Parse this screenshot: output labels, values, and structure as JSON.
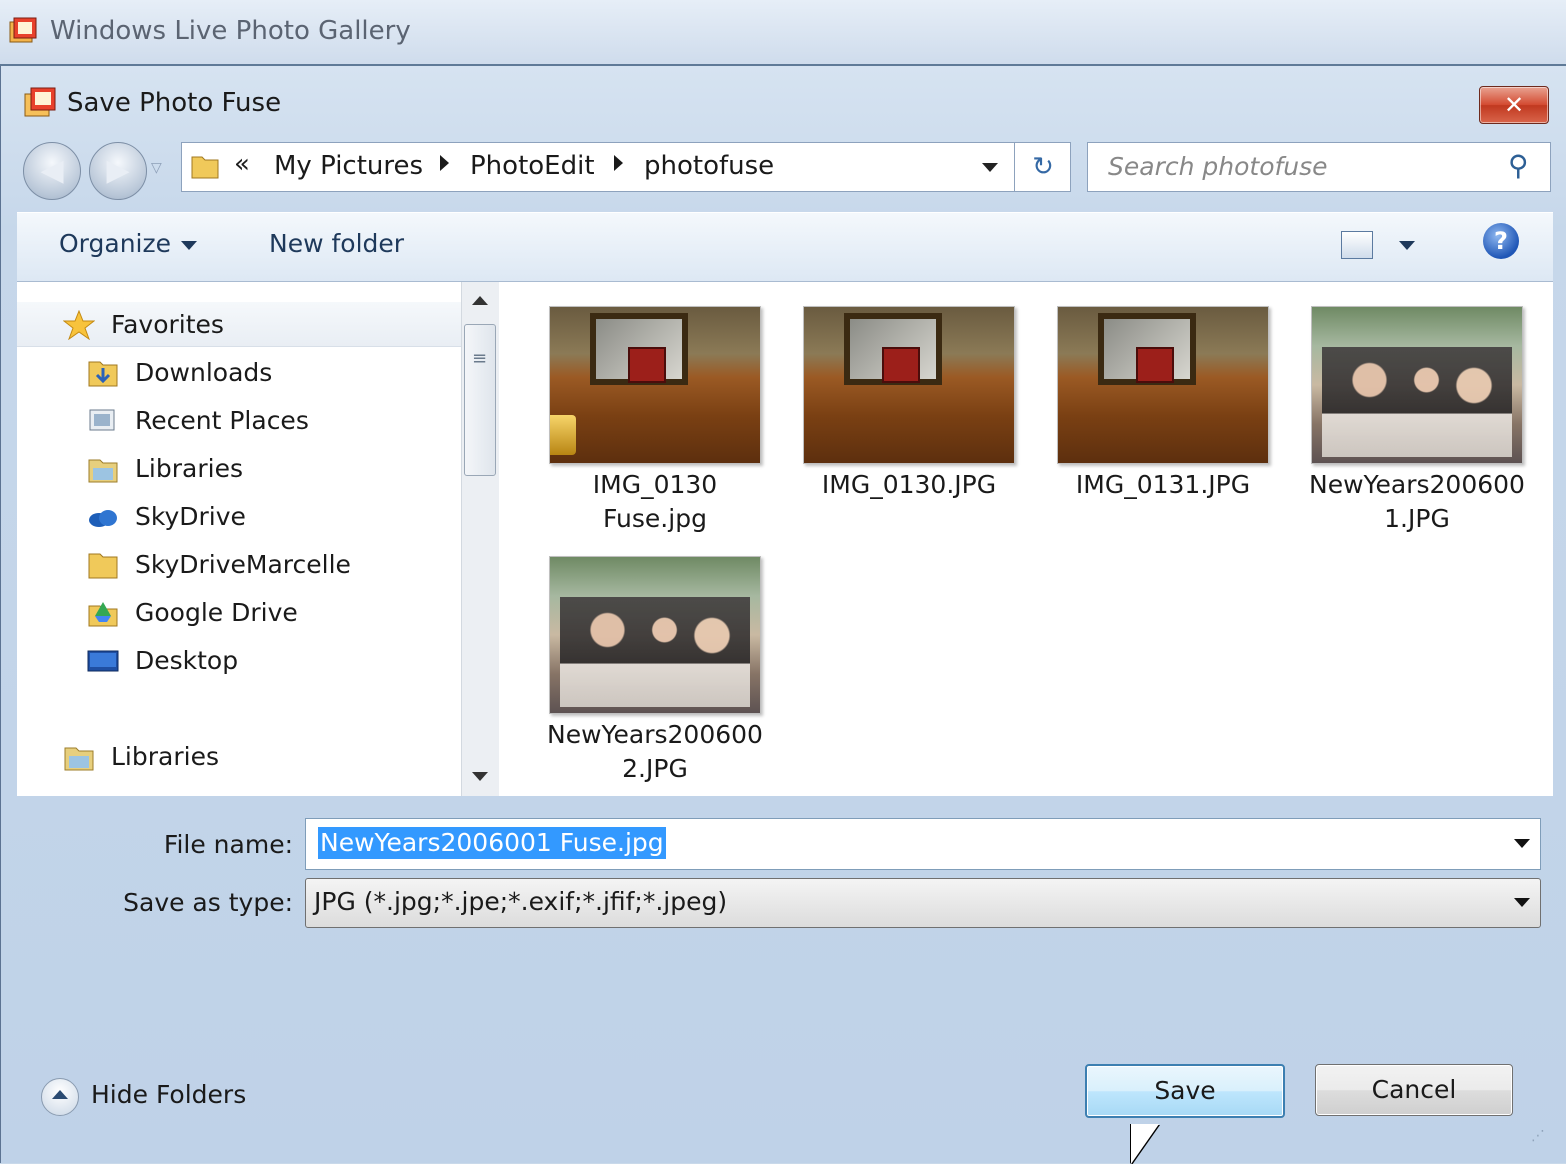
{
  "app": {
    "title": "Windows Live Photo Gallery"
  },
  "dialog": {
    "title": "Save Photo Fuse",
    "close_glyph": "✕"
  },
  "nav": {
    "back_glyph": "◀",
    "forward_glyph": "▶",
    "address_prefix": "«",
    "breadcrumbs": [
      "My Pictures",
      "PhotoEdit",
      "photofuse"
    ],
    "refresh_glyph": "↻"
  },
  "search": {
    "placeholder": "Search photofuse",
    "icon": "search-icon"
  },
  "toolbar": {
    "organize": "Organize",
    "new_folder": "New folder",
    "help_glyph": "?"
  },
  "sidebar": {
    "items": [
      {
        "label": "Favorites",
        "icon": "star-icon"
      },
      {
        "label": "Downloads",
        "icon": "downloads-folder-icon"
      },
      {
        "label": "Recent Places",
        "icon": "recent-places-icon"
      },
      {
        "label": "Libraries",
        "icon": "libraries-icon"
      },
      {
        "label": "SkyDrive",
        "icon": "skydrive-icon"
      },
      {
        "label": "SkyDriveMarcelle",
        "icon": "folder-icon"
      },
      {
        "label": "Google Drive",
        "icon": "google-drive-icon"
      },
      {
        "label": "Desktop",
        "icon": "desktop-icon"
      },
      {
        "label": "Libraries",
        "icon": "libraries-icon"
      }
    ],
    "scroll_grip": "≡"
  },
  "files": [
    {
      "name_line1": "IMG_0130",
      "name_line2": "Fuse.jpg",
      "kind": "cabinet",
      "locked": true
    },
    {
      "name_line1": "IMG_0130.JPG",
      "name_line2": "",
      "kind": "cabinet",
      "locked": false
    },
    {
      "name_line1": "IMG_0131.JPG",
      "name_line2": "",
      "kind": "cabinet",
      "locked": false
    },
    {
      "name_line1": "NewYears200600",
      "name_line2": "1.JPG",
      "kind": "party",
      "locked": false
    },
    {
      "name_line1": "NewYears200600",
      "name_line2": "2.JPG",
      "kind": "party",
      "locked": false
    }
  ],
  "form": {
    "file_name_label": "File name:",
    "file_name_value": "NewYears2006001 Fuse.jpg",
    "save_type_label": "Save as type:",
    "save_type_value": "JPG (*.jpg;*.jpe;*.exif;*.jfif;*.jpeg)"
  },
  "footer": {
    "hide_folders": "Hide Folders",
    "save": "Save",
    "cancel": "Cancel"
  }
}
